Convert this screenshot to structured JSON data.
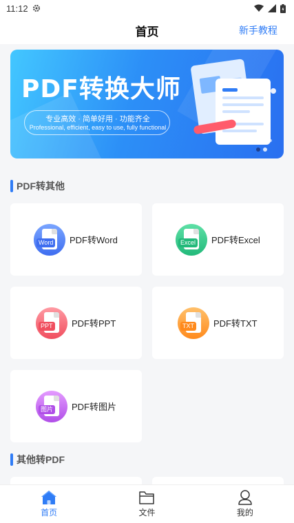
{
  "status_bar": {
    "time": "11:12"
  },
  "header": {
    "title": "首页",
    "tutorial": "新手教程"
  },
  "banner": {
    "title": "PDF转换大师",
    "subtitle_cn": "专业高效 · 简单好用 · 功能齐全",
    "subtitle_en": "Professional, efficient, easy to use, fully functional"
  },
  "sections": [
    {
      "title": "PDF转其他"
    },
    {
      "title": "其他转PDF"
    }
  ],
  "tools": [
    {
      "name": "PDF转Word",
      "tag": "Word",
      "color_top": "#7aa5ff",
      "color_bottom": "#3e6df0",
      "tag_color": "#3e6df0"
    },
    {
      "name": "PDF转Excel",
      "tag": "Excel",
      "color_top": "#5ee0a6",
      "color_bottom": "#22b97a",
      "tag_color": "#22b97a"
    },
    {
      "name": "PDF转PPT",
      "tag": "PPT",
      "color_top": "#ff9aa3",
      "color_bottom": "#f04e5e",
      "tag_color": "#f04e5e"
    },
    {
      "name": "PDF转TXT",
      "tag": "TXT",
      "color_top": "#ffc06a",
      "color_bottom": "#ff8a1c",
      "tag_color": "#ff8a1c"
    },
    {
      "name": "PDF转图片",
      "tag": "图片",
      "color_top": "#e49bff",
      "color_bottom": "#b04ee8",
      "tag_color": "#b04ee8"
    }
  ],
  "bottom_nav": [
    {
      "label": "首页",
      "icon": "home-icon",
      "active": true
    },
    {
      "label": "文件",
      "icon": "folder-icon",
      "active": false
    },
    {
      "label": "我的",
      "icon": "user-icon",
      "active": false
    }
  ],
  "colors": {
    "accent": "#2f7cf6",
    "background": "#f5f6f8"
  }
}
